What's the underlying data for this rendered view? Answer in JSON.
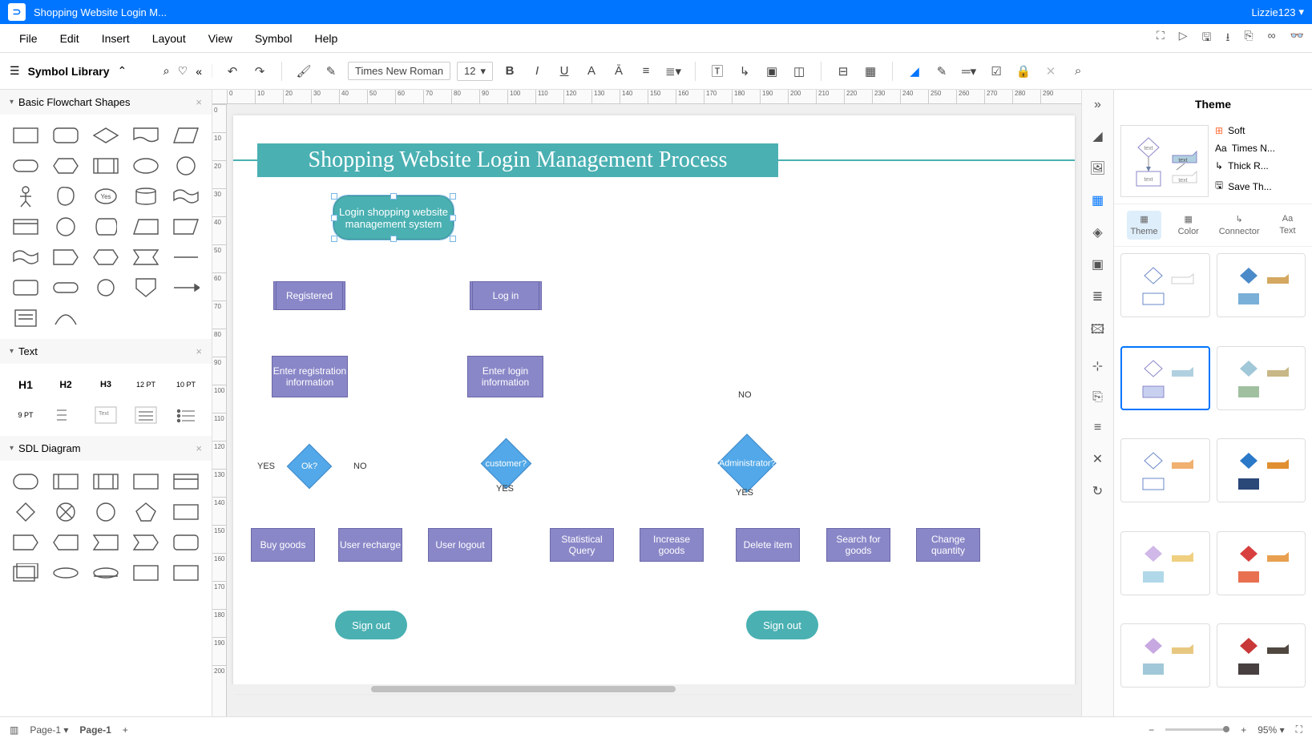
{
  "app": {
    "title": "Shopping Website Login M...",
    "user": "Lizzie123"
  },
  "menu": [
    "File",
    "Edit",
    "Insert",
    "Layout",
    "View",
    "Symbol",
    "Help"
  ],
  "symbolLibrary": {
    "label": "Symbol Library"
  },
  "toolbar": {
    "font": "Times New Roman",
    "fontSize": "12"
  },
  "leftPanel": {
    "sections": [
      {
        "title": "Basic Flowchart Shapes"
      },
      {
        "title": "Text"
      },
      {
        "title": "SDL Diagram"
      }
    ],
    "textHeaders": [
      "H1",
      "H2",
      "H3",
      "12 PT",
      "10 PT",
      "9 PT"
    ]
  },
  "ruler": {
    "hTicks": [
      "0",
      "10",
      "20",
      "30",
      "40",
      "50",
      "60",
      "70",
      "80",
      "90",
      "100",
      "110",
      "120",
      "130",
      "140",
      "150",
      "160",
      "170",
      "180",
      "190",
      "200",
      "210",
      "220",
      "230",
      "240",
      "250",
      "260",
      "270",
      "280",
      "290"
    ],
    "vTicks": [
      "0",
      "10",
      "20",
      "30",
      "40",
      "50",
      "60",
      "70",
      "80",
      "90",
      "100",
      "110",
      "120",
      "130",
      "140",
      "150",
      "160",
      "170",
      "180",
      "190",
      "200"
    ]
  },
  "flowchart": {
    "title": "Shopping Website Login Management Process",
    "nodes": {
      "start": "Login shopping website management system",
      "registered": "Registered",
      "login": "Log in",
      "enterReg": "Enter registration information",
      "enterLogin": "Enter login information",
      "ok": "Ok?",
      "customer": "customer?",
      "admin": "Administrator?",
      "buyGoods": "Buy goods",
      "userRecharge": "User recharge",
      "userLogout": "User logout",
      "statQuery": "Statistical Query",
      "incGoods": "Increase goods",
      "delItem": "Delete item",
      "searchGoods": "Search for goods",
      "changeQty": "Change quantity",
      "signOut1": "Sign out",
      "signOut2": "Sign out"
    },
    "labels": {
      "yes": "YES",
      "no": "NO"
    }
  },
  "themePanel": {
    "title": "Theme",
    "preset": "Soft",
    "font": "Times N...",
    "connector": "Thick R...",
    "save": "Save Th...",
    "tabs": [
      "Theme",
      "Color",
      "Connector",
      "Text"
    ]
  },
  "pageTabs": {
    "current": "Page-1",
    "label": "Page-1"
  },
  "status": {
    "zoom": "95%"
  }
}
